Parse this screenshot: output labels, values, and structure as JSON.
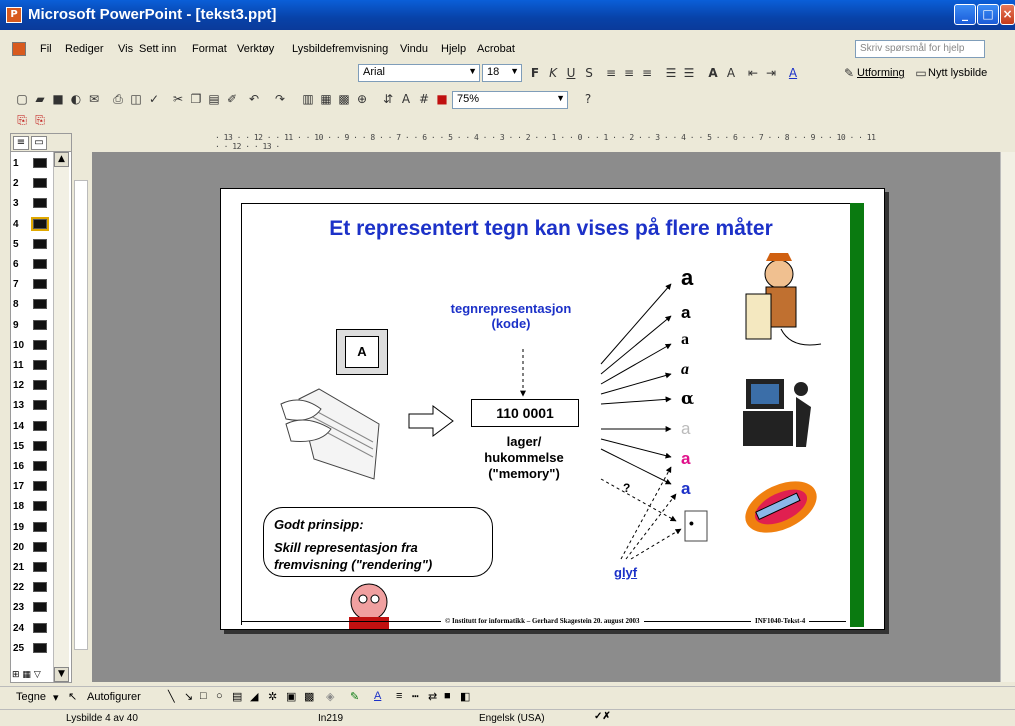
{
  "window": {
    "title": "Microsoft PowerPoint - [tekst3.ppt]"
  },
  "menu": {
    "items": [
      "Fil",
      "Rediger",
      "Vis",
      "Sett inn",
      "Format",
      "Verktøy",
      "Lysbildefremvisning",
      "Vindu",
      "Hjelp",
      "Acrobat"
    ],
    "help_placeholder": "Skriv spørsmål for hjelp"
  },
  "formatting": {
    "font": "Arial",
    "size": "18",
    "design_label": "Utforming",
    "new_slide_label": "Nytt lysbilde"
  },
  "standard": {
    "zoom": "75%"
  },
  "ruler": {
    "text": "· 13 · · 12 · · 11 · · 10 · · 9 · · 8 · · 7 · · 6 · · 5 · · 4 · · 3 · · 2 · · 1 · · 0 · · 1 · · 2 · · 3 · · 4 · · 5 · · 6 · · 7 · · 8 · · 9 · · 10 · · 11 · · 12 · · 13 ·"
  },
  "slides": {
    "numbers": [
      "1",
      "2",
      "3",
      "4",
      "5",
      "6",
      "7",
      "8",
      "9",
      "10",
      "11",
      "12",
      "13",
      "14",
      "15",
      "16",
      "17",
      "18",
      "19",
      "20",
      "21",
      "22",
      "23",
      "24",
      "25"
    ],
    "active": "4"
  },
  "slide": {
    "title": "Et representert tegn kan vises på flere måter",
    "key_label": "A",
    "code_label": "tegnrepresentasjon (kode)",
    "binary": "110 0001",
    "memory_label": "lager/ hukommelse (\"memory\")",
    "question": "?",
    "glyphs": [
      "a",
      "a",
      "a",
      "a",
      "α",
      "a",
      "a",
      "a",
      "•"
    ],
    "bubble_line1": "Godt prinsipp:",
    "bubble_line2": "Skill representasjon fra fremvisning (\"rendering\")",
    "glyph_label": "glyf",
    "footer_left": "© Institutt for informatikk – Gerhard Skagestein 20. august 2003",
    "footer_right": "INF1040-Tekst-4"
  },
  "drawing": {
    "draw_label": "Tegne",
    "autoshapes_label": "Autofigurer"
  },
  "status": {
    "slide_info": "Lysbilde 4 av 40",
    "design": "In219",
    "language": "Engelsk (USA)"
  }
}
